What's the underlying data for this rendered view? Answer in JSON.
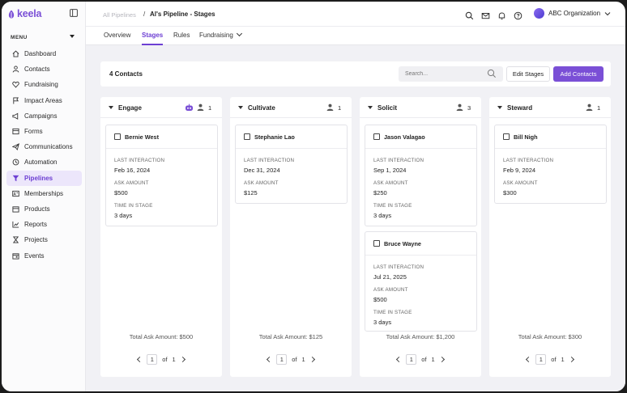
{
  "app": {
    "logo_text": "keela",
    "brand_color": "#7a4fd6"
  },
  "sidebar": {
    "menu_label": "MENU",
    "items": [
      {
        "label": "Dashboard",
        "icon": "home-icon"
      },
      {
        "label": "Contacts",
        "icon": "person-icon"
      },
      {
        "label": "Fundraising",
        "icon": "heart-icon"
      },
      {
        "label": "Impact Areas",
        "icon": "flag-icon"
      },
      {
        "label": "Campaigns",
        "icon": "megaphone-icon"
      },
      {
        "label": "Forms",
        "icon": "form-icon"
      },
      {
        "label": "Communications",
        "icon": "send-icon"
      },
      {
        "label": "Automation",
        "icon": "automation-icon"
      },
      {
        "label": "Pipelines",
        "icon": "filter-icon",
        "active": true
      },
      {
        "label": "Memberships",
        "icon": "id-card-icon"
      },
      {
        "label": "Products",
        "icon": "box-icon"
      },
      {
        "label": "Reports",
        "icon": "chart-icon"
      },
      {
        "label": "Projects",
        "icon": "hourglass-icon"
      },
      {
        "label": "Events",
        "icon": "calendar-icon"
      }
    ]
  },
  "header": {
    "breadcrumb_parent": "All Pipelines",
    "breadcrumb_sep": "/",
    "breadcrumb_current": "Al's Pipeline - Stages",
    "org_name": "ABC Organization"
  },
  "tabs": [
    {
      "label": "Overview"
    },
    {
      "label": "Stages",
      "active": true
    },
    {
      "label": "Rules"
    },
    {
      "label": "Fundraising"
    }
  ],
  "toolbar": {
    "count_label": "4 Contacts",
    "search_placeholder": "Search...",
    "edit_label": "Edit Stages",
    "add_label": "Add Contacts"
  },
  "labels": {
    "last_interaction": "LAST INTERACTION",
    "ask_amount": "ASK AMOUNT",
    "time_in_stage": "TIME IN STAGE",
    "of": "of"
  },
  "columns": [
    {
      "title": "Engage",
      "count": "1",
      "has_bot": true,
      "total": "Total Ask Amount: $500",
      "page": "1",
      "pages": "1",
      "cards": [
        {
          "name": "Bernie West",
          "last_interaction": "Feb 16, 2024",
          "ask_amount": "$500",
          "time_in_stage": "3 days"
        }
      ]
    },
    {
      "title": "Cultivate",
      "count": "1",
      "has_bot": false,
      "total": "Total Ask Amount: $125",
      "page": "1",
      "pages": "1",
      "cards": [
        {
          "name": "Stephanie Lao",
          "last_interaction": "Dec 31, 2024",
          "ask_amount": "$125"
        }
      ]
    },
    {
      "title": "Solicit",
      "count": "3",
      "has_bot": false,
      "total": "Total Ask Amount: $1,200",
      "page": "1",
      "pages": "1",
      "cards": [
        {
          "name": "Jason Valagao",
          "last_interaction": "Sep 1, 2024",
          "ask_amount": "$250",
          "time_in_stage": "3 days"
        },
        {
          "name": "Bruce Wayne",
          "last_interaction": "Jul 21, 2025",
          "ask_amount": "$500",
          "time_in_stage": "3 days"
        }
      ]
    },
    {
      "title": "Steward",
      "count": "1",
      "has_bot": false,
      "total": "Total Ask Amount: $300",
      "page": "1",
      "pages": "1",
      "cards": [
        {
          "name": "Bill Nigh",
          "last_interaction": "Feb 9, 2024",
          "ask_amount": "$300"
        }
      ]
    }
  ]
}
